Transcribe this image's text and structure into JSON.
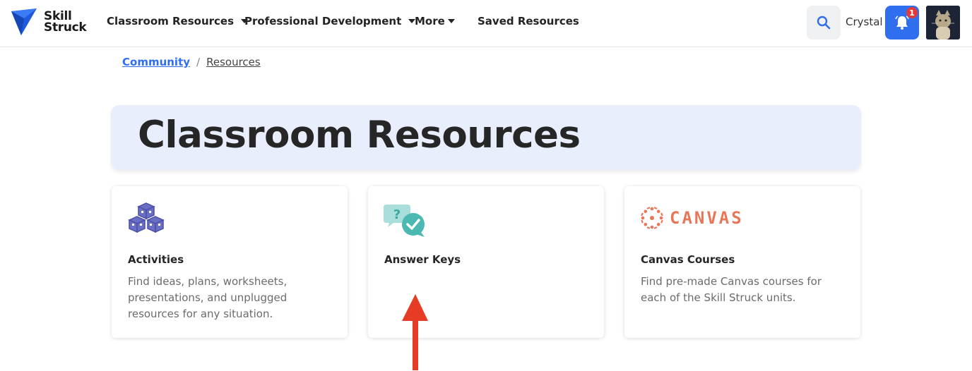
{
  "brand": {
    "line1": "Skill",
    "line2": "Struck"
  },
  "nav": {
    "items": [
      {
        "label": "Classroom Resources",
        "dropdown": true
      },
      {
        "label": "Professional Development",
        "dropdown": true
      },
      {
        "label": "More",
        "dropdown": true
      },
      {
        "label": "Saved Resources",
        "dropdown": false
      }
    ],
    "search_icon": "search-icon",
    "username": "Crystal",
    "notifications": {
      "icon": "bell-icon",
      "count": "1"
    }
  },
  "breadcrumb": {
    "parent": "Community",
    "separator": "/",
    "current": "Resources"
  },
  "hero": {
    "title": "Classroom Resources"
  },
  "cards": [
    {
      "icon": "cubes-icon",
      "title": "Activities",
      "description": "Find ideas, plans, worksheets, presentations, and unplugged resources for any situation."
    },
    {
      "icon": "question-check-bubbles-icon",
      "title": "Answer Keys",
      "description": ""
    },
    {
      "icon": "canvas-logo-icon",
      "logo_text": "CANVAS",
      "title": "Canvas Courses",
      "description": "Find pre-made Canvas courses for each of the Skill Struck units."
    }
  ],
  "annotation": {
    "icon": "red-arrow-up-icon"
  },
  "colors": {
    "accent": "#2f6fef",
    "hero_bg": "#e8eefb",
    "badge": "#e03a3a",
    "canvas": "#e8775a",
    "cube": "#6a6fc4",
    "bubbles": "#5cc3be",
    "arrow": "#e63b24"
  }
}
